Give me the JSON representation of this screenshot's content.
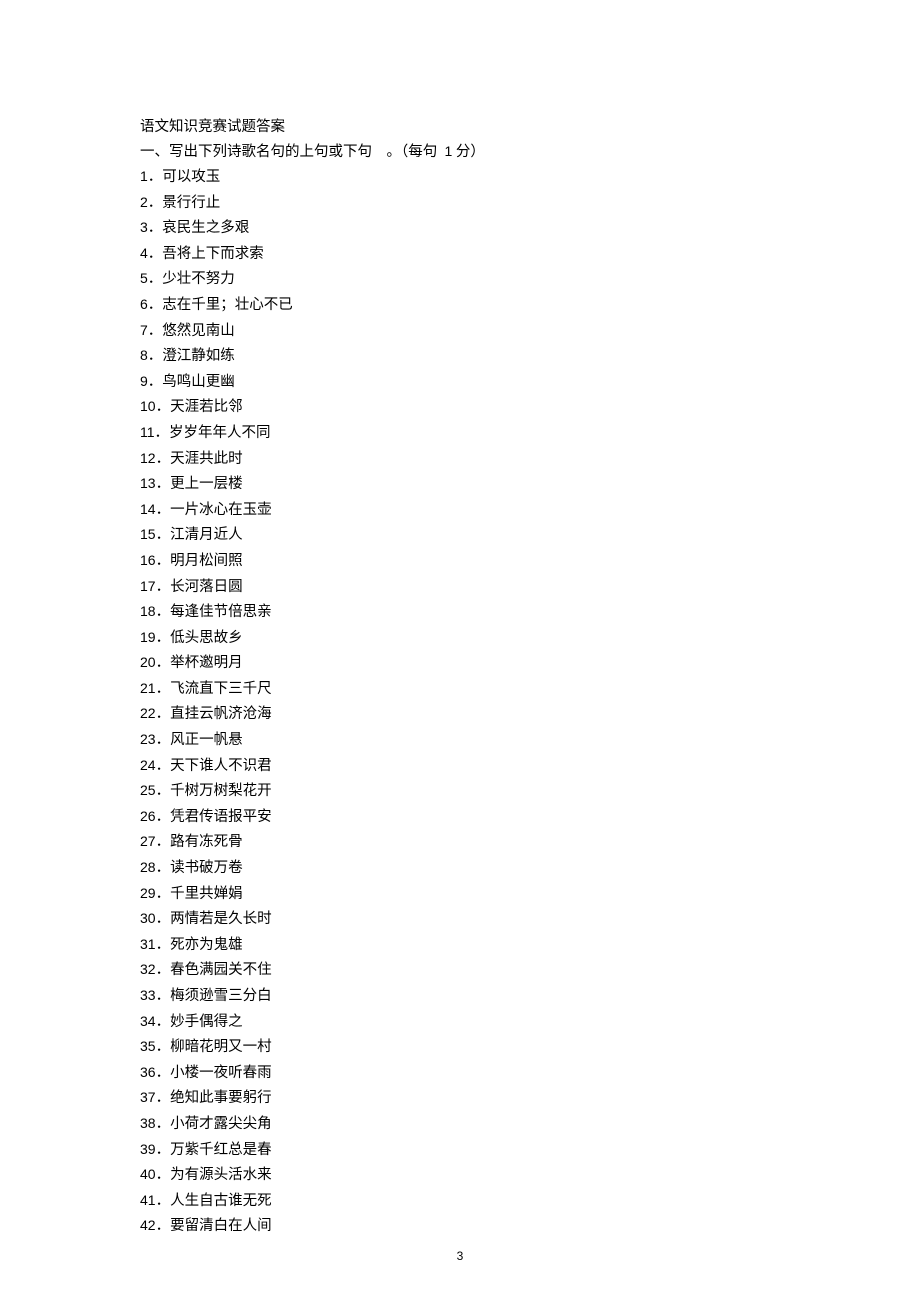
{
  "title": "语文知识竞赛试题答案",
  "section_heading_prefix": "一、写出下列诗歌名句的上句或下句",
  "section_heading_suffix": "。（每句",
  "section_heading_points_num": "1",
  "section_heading_points_unit": "分）",
  "items": [
    {
      "num": "1",
      "text": "可以攻玉"
    },
    {
      "num": "2",
      "text": "景行行止"
    },
    {
      "num": "3",
      "text": "哀民生之多艰"
    },
    {
      "num": "4",
      "text": "吾将上下而求索"
    },
    {
      "num": "5",
      "text": "少壮不努力"
    },
    {
      "num": "6",
      "text": "志在千里；壮心不已"
    },
    {
      "num": "7",
      "text": "悠然见南山"
    },
    {
      "num": "8",
      "text": "澄江静如练"
    },
    {
      "num": "9",
      "text": "鸟鸣山更幽"
    },
    {
      "num": "10",
      "text": "天涯若比邻"
    },
    {
      "num": "11",
      "text": "岁岁年年人不同"
    },
    {
      "num": "12",
      "text": "天涯共此时"
    },
    {
      "num": "13",
      "text": "更上一层楼"
    },
    {
      "num": "14",
      "text": "一片冰心在玉壶"
    },
    {
      "num": "15",
      "text": "江清月近人"
    },
    {
      "num": "16",
      "text": "明月松间照"
    },
    {
      "num": "17",
      "text": "长河落日圆"
    },
    {
      "num": "18",
      "text": "每逢佳节倍思亲"
    },
    {
      "num": "19",
      "text": "低头思故乡"
    },
    {
      "num": "20",
      "text": "举杯邀明月"
    },
    {
      "num": "21",
      "text": "飞流直下三千尺"
    },
    {
      "num": "22",
      "text": "直挂云帆济沧海"
    },
    {
      "num": "23",
      "text": "风正一帆悬"
    },
    {
      "num": "24",
      "text": "天下谁人不识君"
    },
    {
      "num": "25",
      "text": "千树万树梨花开"
    },
    {
      "num": "26",
      "text": "凭君传语报平安"
    },
    {
      "num": "27",
      "text": "路有冻死骨"
    },
    {
      "num": "28",
      "text": "读书破万卷"
    },
    {
      "num": "29",
      "text": "千里共婵娟"
    },
    {
      "num": "30",
      "text": "两情若是久长时"
    },
    {
      "num": "31",
      "text": "死亦为鬼雄"
    },
    {
      "num": "32",
      "text": "春色满园关不住"
    },
    {
      "num": "33",
      "text": "梅须逊雪三分白"
    },
    {
      "num": "34",
      "text": "妙手偶得之"
    },
    {
      "num": "35",
      "text": "柳暗花明又一村"
    },
    {
      "num": "36",
      "text": "小楼一夜听春雨"
    },
    {
      "num": "37",
      "text": "绝知此事要躬行"
    },
    {
      "num": "38",
      "text": "小荷才露尖尖角"
    },
    {
      "num": "39",
      "text": "万紫千红总是春"
    },
    {
      "num": "40",
      "text": "为有源头活水来"
    },
    {
      "num": "41",
      "text": "人生自古谁无死"
    },
    {
      "num": "42",
      "text": "要留清白在人间"
    }
  ],
  "page_number": "3"
}
